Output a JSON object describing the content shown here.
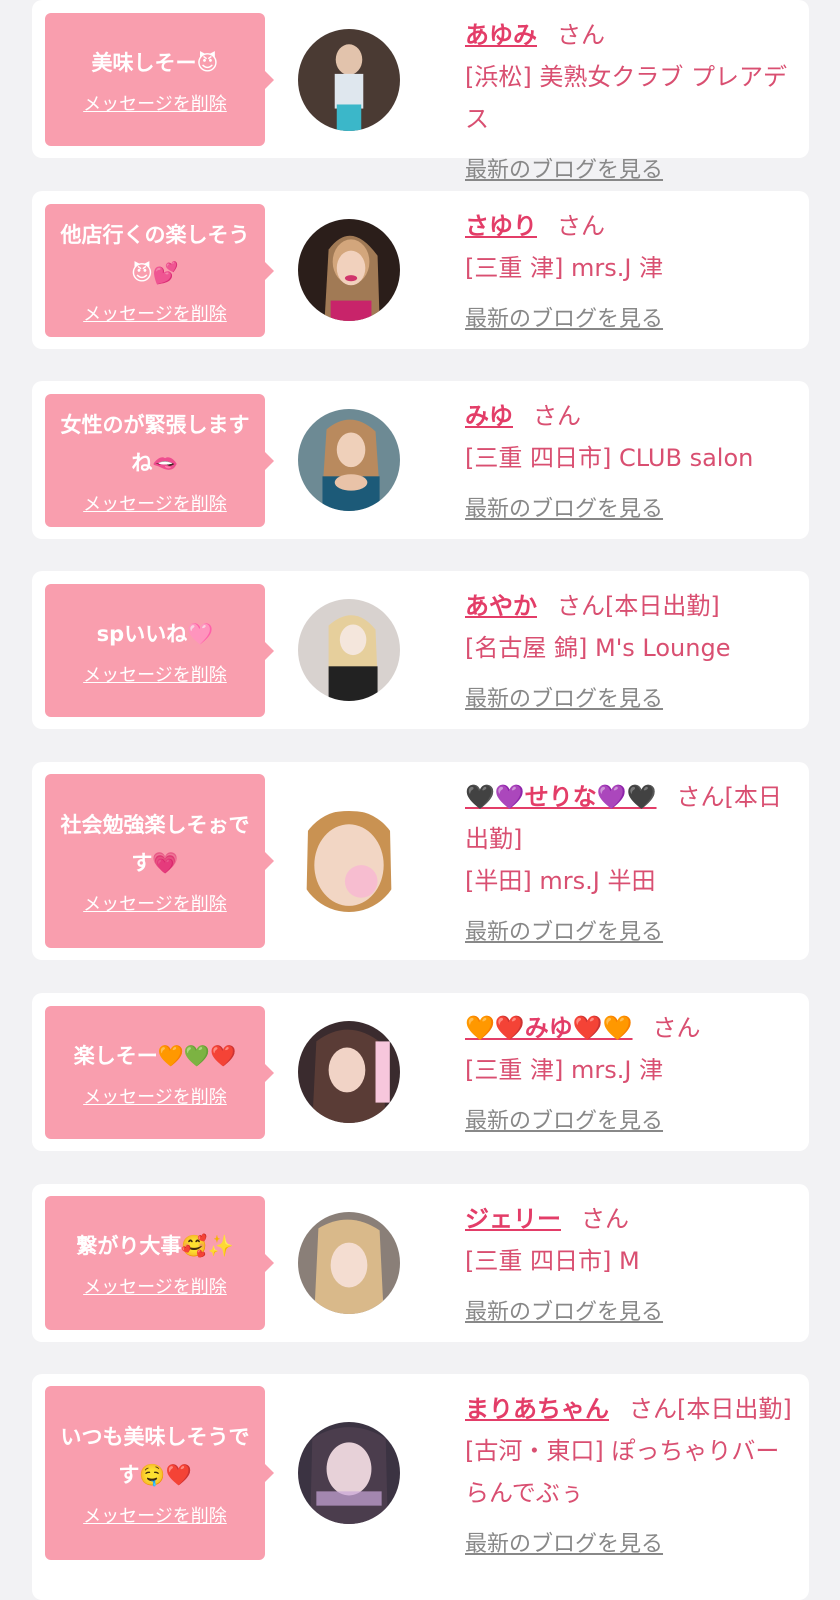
{
  "delete_label": "メッセージを削除",
  "blog_label": "最新のブログを見る",
  "colors": {
    "bubble": "#f99eae",
    "name": "#e33d68",
    "text": "#d94f71",
    "link": "#888888",
    "background": "#f2f2f4"
  },
  "entries": [
    {
      "message": "美味しそー😈",
      "name": "あゆみ",
      "suffix": "さん",
      "shop": "[浜松] 美熟女クラブ プレアデス",
      "avatar_icon": "woman-photo"
    },
    {
      "message": "他店行くの楽しそう😈💕",
      "name": "さゆり",
      "suffix": "さん",
      "shop": "[三重 津] mrs.J 津",
      "avatar_icon": "woman-photo"
    },
    {
      "message": "女性のが緊張しますね🫦",
      "name": "みゆ",
      "suffix": "さん",
      "shop": "[三重 四日市] CLUB salon",
      "avatar_icon": "woman-photo"
    },
    {
      "message": "spいいね🩷",
      "name": "あやか",
      "suffix": "さん[本日出勤]",
      "shop": "[名古屋 錦] M's Lounge",
      "avatar_icon": "woman-photo"
    },
    {
      "message": "社会勉強楽しそぉです💗",
      "name": "🖤💜せりな💜🖤",
      "suffix": "さん[本日出勤]",
      "shop": "[半田] mrs.J 半田",
      "avatar_icon": "woman-photo"
    },
    {
      "message": "楽しそー🧡💚❤️",
      "name": "🧡❤️みゆ❤️🧡",
      "suffix": "さん",
      "shop": "[三重 津] mrs.J 津",
      "avatar_icon": "woman-photo"
    },
    {
      "message": "繋がり大事🥰✨",
      "name": "ジェリー",
      "suffix": "さん",
      "shop": "[三重 四日市] M",
      "avatar_icon": "woman-photo"
    },
    {
      "message": "いつも美味しそうです🤤❤️",
      "name": "まりあちゃん",
      "suffix": "さん[本日出勤]",
      "shop": "[古河・東口] ぽっちゃりバー らんでぶぅ",
      "avatar_icon": "woman-photo"
    }
  ]
}
